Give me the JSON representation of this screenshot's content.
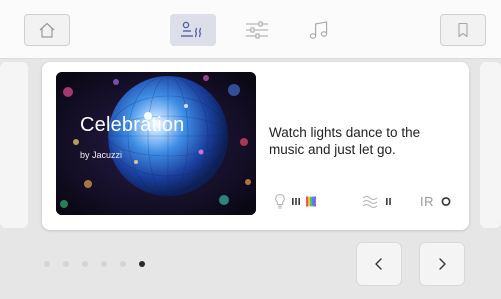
{
  "program": {
    "title": "Celebration",
    "subtitle": "by Jacuzzi",
    "description": "Watch lights dance to the music and just let go.",
    "ir_label": "IR"
  },
  "pagination": {
    "total_pages": 6,
    "current_page": 6
  },
  "colors": {
    "active_tab_bg": "#dcdfe9",
    "accent_blue": "#4a5a9a"
  }
}
